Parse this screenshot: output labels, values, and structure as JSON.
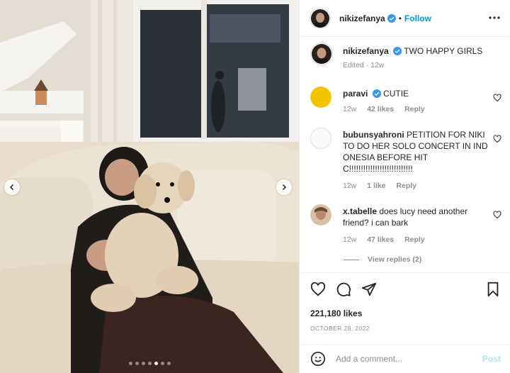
{
  "post": {
    "author": "nikizefanya",
    "follow_label": "Follow",
    "separator": "•",
    "caption_text": "TWO HAPPY GIRLS",
    "caption_meta": "Edited · 12w"
  },
  "comments": [
    {
      "user": "paravi",
      "verified": true,
      "text": "CUTIE",
      "time": "12w",
      "likes": "42 likes",
      "reply": "Reply"
    },
    {
      "user": "bubunsyahroni",
      "verified": false,
      "text": "PETITION FOR NIKI TO DO HER SOLO CONCERT IN INDONESIA BEFORE HITC!!!!!!!!!!!!!!!!!!!!!!!!!!!",
      "time": "12w",
      "likes": "1 like",
      "reply": "Reply"
    },
    {
      "user": "x.tabelle",
      "verified": false,
      "text": "does lucy need another friend? i can bark",
      "time": "12w",
      "likes": "47 likes",
      "reply": "Reply",
      "view_replies": "View replies (2)"
    }
  ],
  "engagement": {
    "likes_count": "221,180 likes",
    "date": "OCTOBER 28, 2022"
  },
  "comment_box": {
    "placeholder": "Add a comment...",
    "post_label": "Post"
  },
  "carousel": {
    "total": 7,
    "active_index": 4
  },
  "colors": {
    "accent": "#0095f6",
    "verified": "#3897f0",
    "post_disabled": "#b2dffc"
  },
  "icons": [
    "chevron-left-icon",
    "chevron-right-icon",
    "more-icon",
    "verified-icon",
    "heart-icon",
    "comment-icon",
    "share-icon",
    "bookmark-icon",
    "smile-icon"
  ]
}
